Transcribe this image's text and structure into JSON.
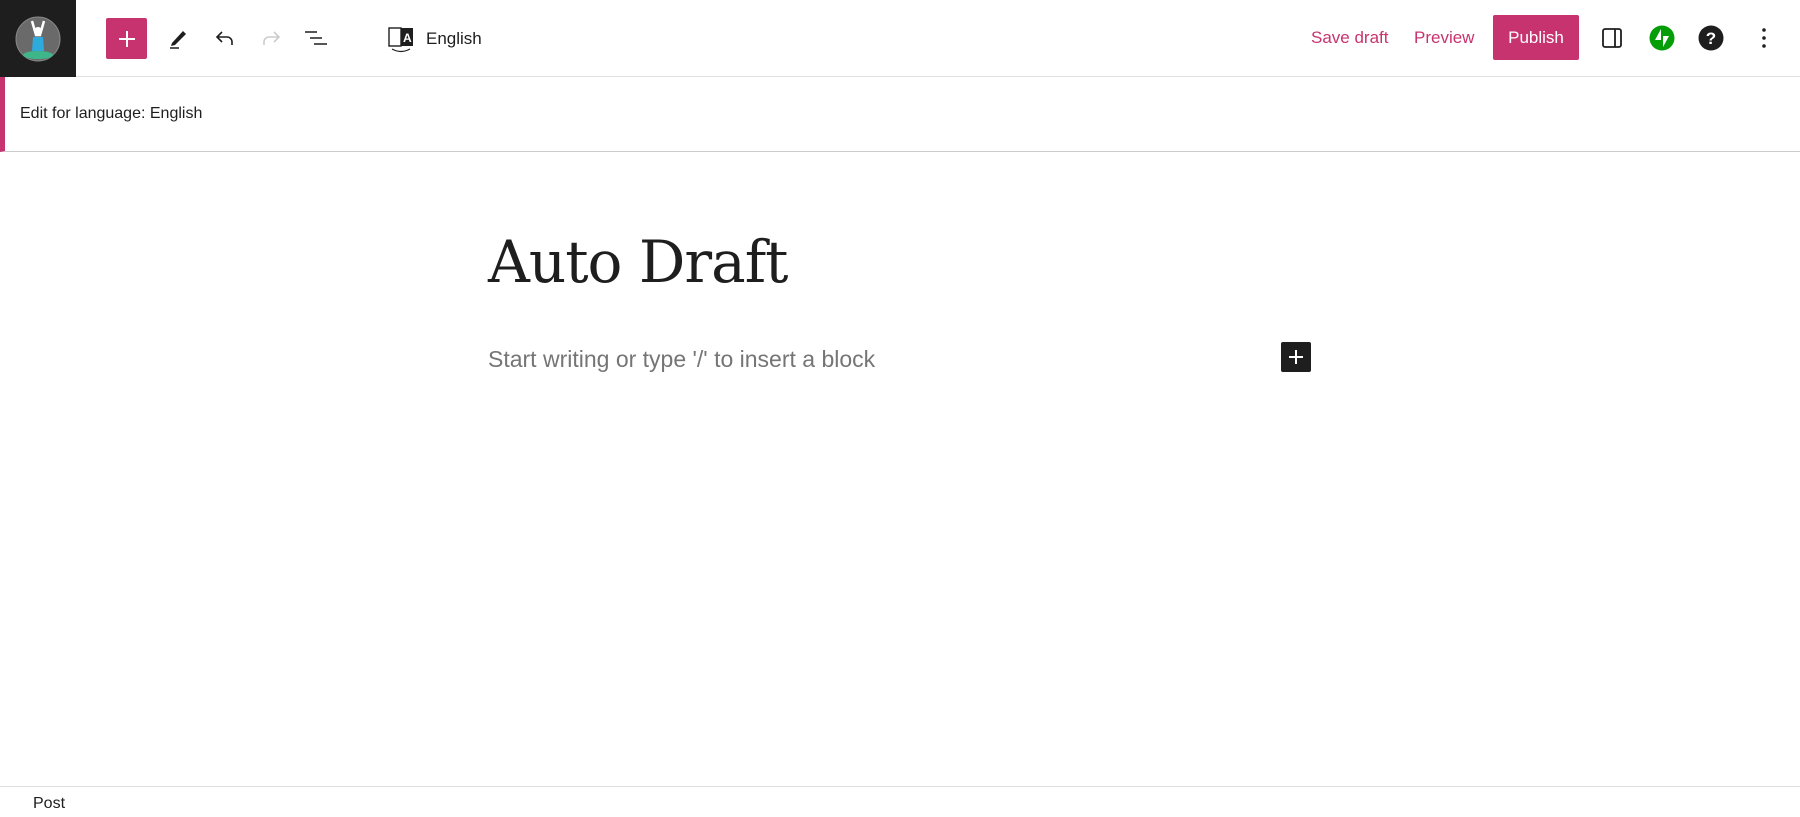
{
  "header": {
    "logo": "site-logo-yoga",
    "language": "English",
    "save_draft": "Save draft",
    "preview": "Preview",
    "publish": "Publish",
    "accent": "#c7336f"
  },
  "notice": {
    "text": "Edit for language: English"
  },
  "editor": {
    "title": "Auto Draft",
    "placeholder": "Start writing or type '/' to insert a block"
  },
  "footer": {
    "breadcrumb": "Post"
  }
}
